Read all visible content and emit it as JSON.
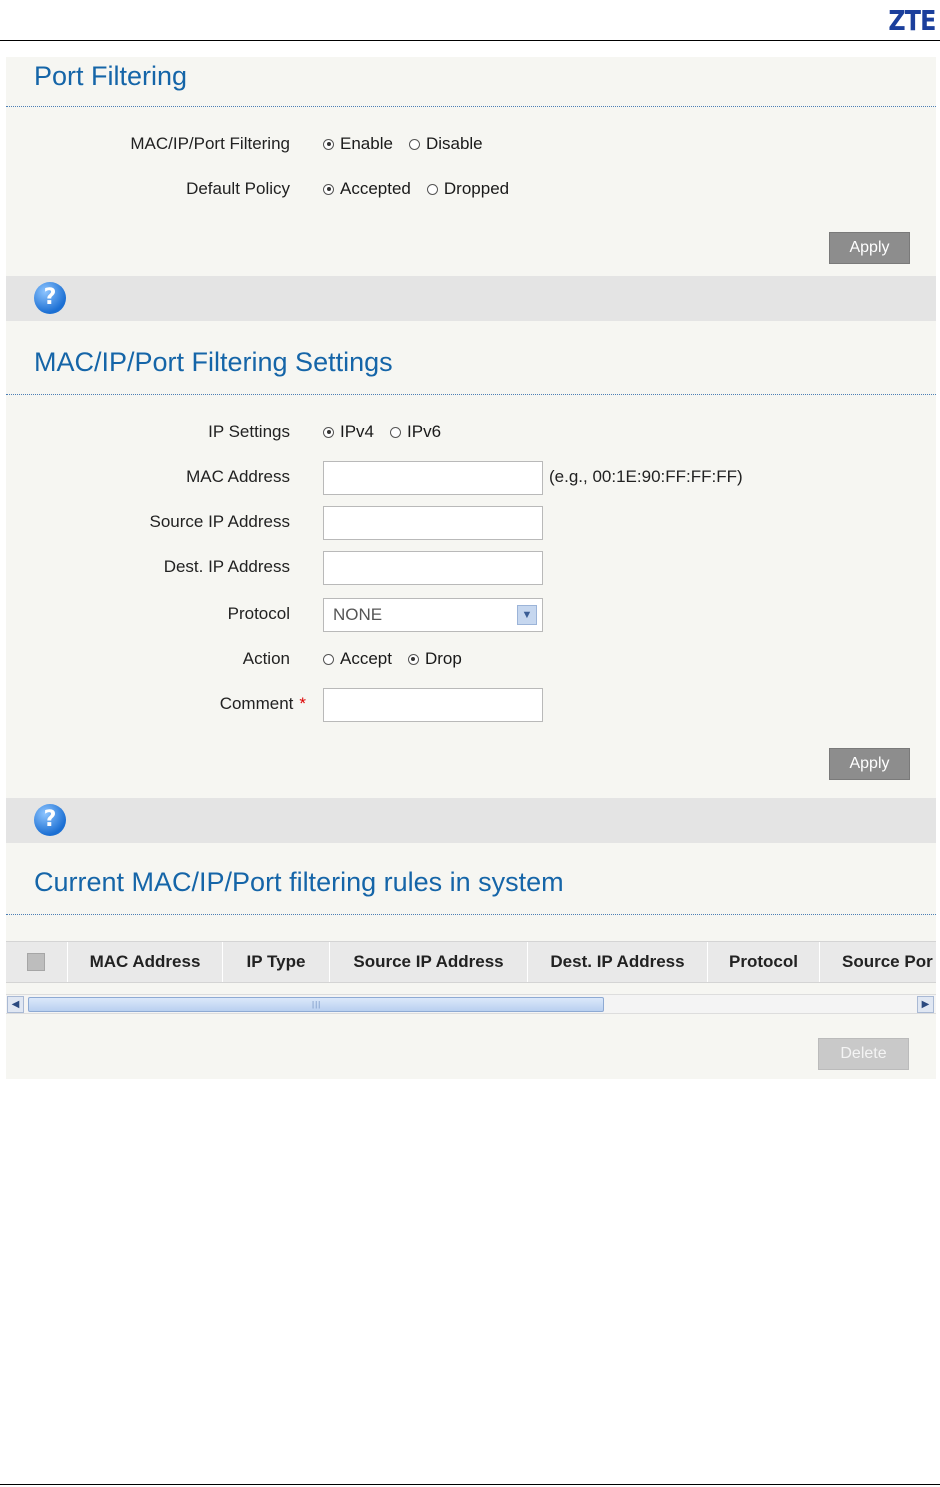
{
  "brand": {
    "logo_text": "ZTE",
    "color": "#1b3f9c"
  },
  "port_filtering": {
    "title": "Port Filtering",
    "filtering_label": "MAC/IP/Port Filtering",
    "filtering_options": [
      {
        "label": "Enable",
        "selected": true
      },
      {
        "label": "Disable",
        "selected": false
      }
    ],
    "policy_label": "Default Policy",
    "policy_options": [
      {
        "label": "Accepted",
        "selected": true
      },
      {
        "label": "Dropped",
        "selected": false
      }
    ],
    "apply_label": "Apply"
  },
  "help_icon_text": "?",
  "settings": {
    "title": "MAC/IP/Port Filtering Settings",
    "ip_settings_label": "IP Settings",
    "ip_options": [
      {
        "label": "IPv4",
        "selected": true
      },
      {
        "label": "IPv6",
        "selected": false
      }
    ],
    "mac_label": "MAC Address",
    "mac_value": "",
    "mac_hint": "(e.g., 00:1E:90:FF:FF:FF)",
    "source_ip_label": "Source IP Address",
    "source_ip_value": "",
    "dest_ip_label": "Dest. IP Address",
    "dest_ip_value": "",
    "protocol_label": "Protocol",
    "protocol_value": "NONE",
    "action_label": "Action",
    "action_options": [
      {
        "label": "Accept",
        "selected": false
      },
      {
        "label": "Drop",
        "selected": true
      }
    ],
    "comment_label": "Comment",
    "comment_required": "*",
    "comment_value": "",
    "apply_label": "Apply"
  },
  "rules": {
    "title": "Current MAC/IP/Port filtering rules in system",
    "columns": [
      "MAC Address",
      "IP Type",
      "Source IP Address",
      "Dest. IP Address",
      "Protocol",
      "Source Por"
    ],
    "rows": [],
    "delete_label": "Delete"
  },
  "colors": {
    "accent": "#1565a8",
    "button": "#8d8d8d",
    "panel": "#f6f6f2"
  }
}
